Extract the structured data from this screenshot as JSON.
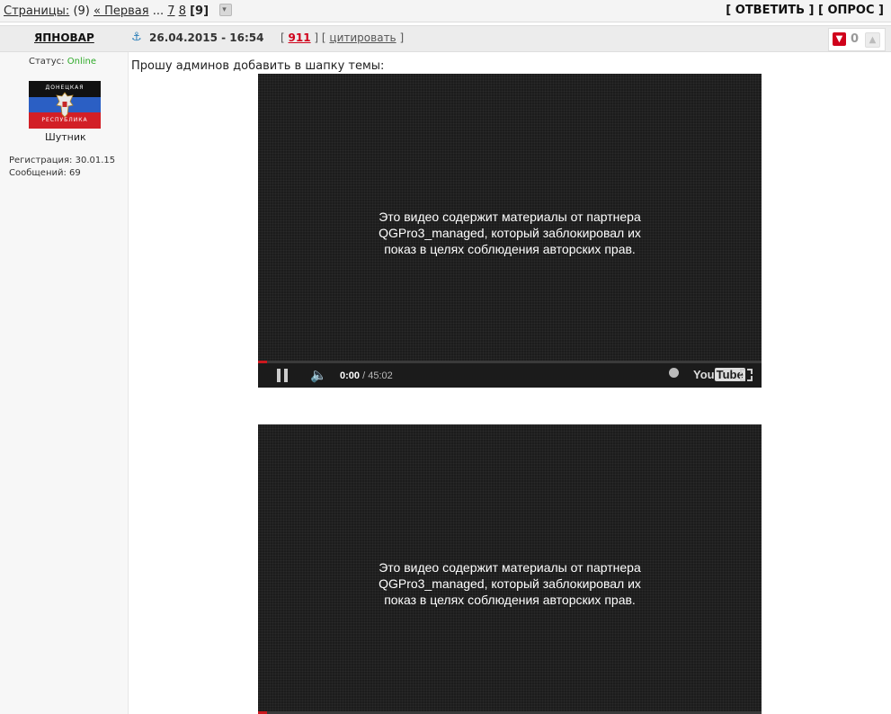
{
  "pagination": {
    "label": "Страницы:",
    "total": "(9)",
    "first": "« Первая",
    "ellipsis": "...",
    "page_a": "7",
    "page_b": "8",
    "current": "[9]"
  },
  "actions": {
    "reply": "[ ОТВЕТИТЬ ]",
    "poll": "[ ОПРОС ]"
  },
  "post": {
    "author": "ЯПНОВАР",
    "date": "26.04.2015 - 16:54",
    "bracket_open": "[",
    "number": "911",
    "bracket_mid": "] [",
    "quote": "цитировать",
    "bracket_close": "]",
    "rating": "0",
    "message": "Прошу админов добавить в шапку темы:"
  },
  "user": {
    "status_label": "Статус:",
    "status_value": "Online",
    "flag_top_text": "ДОНЕЦКАЯ",
    "flag_bottom_text": "РЕСПУБЛИКА",
    "rank": "Шутник",
    "registration": "Регистрация: 30.01.15",
    "messages": "Сообщений: 69"
  },
  "video1": {
    "line1": "Это видео содержит материалы от партнера",
    "line2": "QGPro3_managed, который заблокировал их",
    "line3": "показ в целях соблюдения авторских прав.",
    "time_current": "0:00",
    "time_sep": " / ",
    "time_total": "45:02",
    "logo_you": "You",
    "logo_tube": "Tube"
  },
  "video2": {
    "line1": "Это видео содержит материалы от партнера",
    "line2": "QGPro3_managed, который заблокировал их",
    "line3": "показ в целях соблюдения авторских прав."
  },
  "icons": {
    "anchor": "anchor-icon",
    "dropdown": "chevron-down-icon",
    "thumb_down": "thumb-down-icon",
    "thumb_up": "thumb-up-icon"
  },
  "colors": {
    "accent_red": "#d0021b",
    "online_green": "#2eaa28",
    "anchor_blue": "#2c7fb8"
  }
}
